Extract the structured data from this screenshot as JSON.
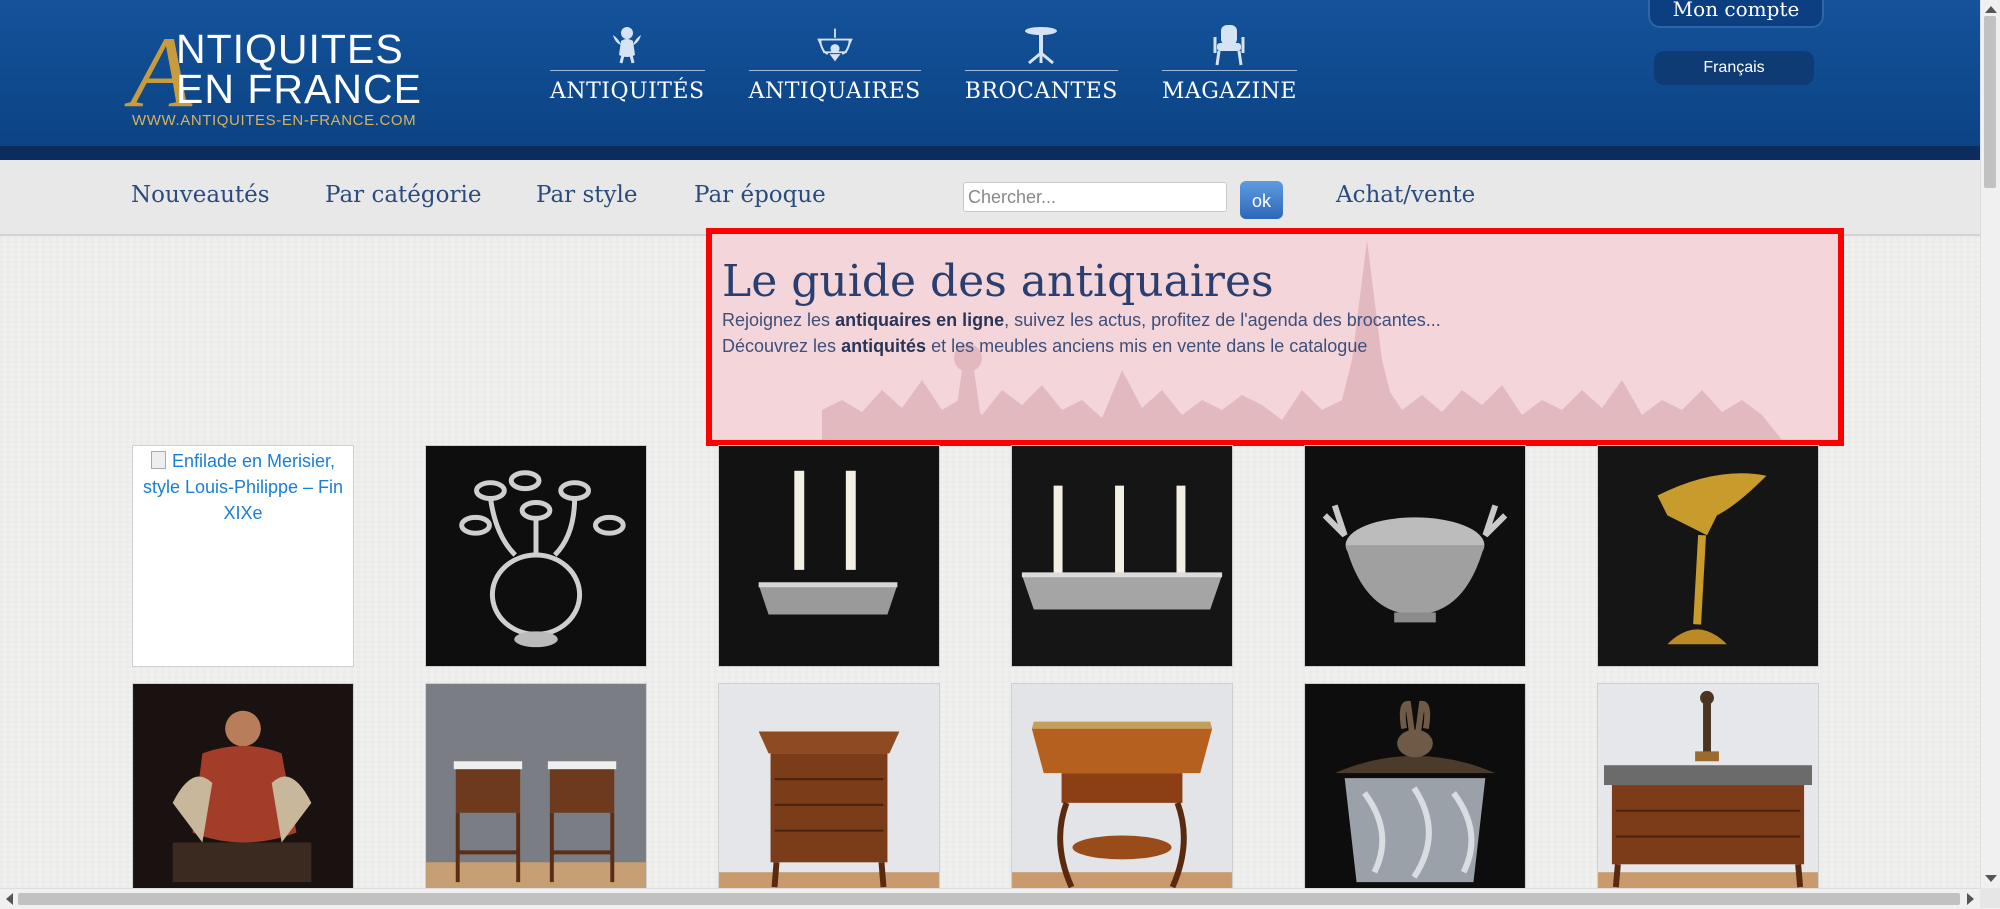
{
  "logo": {
    "line1": "NTIQUITES",
    "line2": "EN FRANCE",
    "big_letter": "A",
    "url": "WWW.ANTIQUITES-EN-FRANCE.COM"
  },
  "main_nav": [
    {
      "label": "ANTIQUITÉS",
      "icon": "cherub-icon"
    },
    {
      "label": "ANTIQUAIRES",
      "icon": "chandelier-icon"
    },
    {
      "label": "BROCANTES",
      "icon": "pedestal-table-icon"
    },
    {
      "label": "MAGAZINE",
      "icon": "armchair-icon"
    }
  ],
  "account": {
    "label": "Mon compte"
  },
  "language": {
    "label": "Français"
  },
  "sub_nav": {
    "items": [
      "Nouveautés",
      "Par catégorie",
      "Par style",
      "Par époque"
    ],
    "achat": "Achat/vente"
  },
  "search": {
    "placeholder": "Chercher...",
    "button": "ok"
  },
  "hero": {
    "title": "Le guide des antiquaires",
    "line1_pre": "Rejoignez les ",
    "line1_bold": "antiquaires en ligne",
    "line1_post": ", suivez les actus, profitez de l'agenda des brocantes...",
    "line2_pre": "Découvrez les ",
    "line2_bold": "antiquités",
    "line2_post": " et les meubles anciens mis en vente dans le catalogue"
  },
  "products": [
    {
      "alt": "Enfilade en Merisier, style Louis-Philippe – Fin XIXe",
      "broken": true
    },
    {
      "name": "crystal candelabra"
    },
    {
      "name": "silver two-candle holder"
    },
    {
      "name": "silver three-candle tray"
    },
    {
      "name": "silver bowl with stag heads"
    },
    {
      "name": "gilt eagle sculpture"
    },
    {
      "name": "carved angel sculpture"
    },
    {
      "name": "pair of bedside tables"
    },
    {
      "name": "small chest of drawers"
    },
    {
      "name": "marquetry side table"
    },
    {
      "name": "crystal jar with rabbit lid"
    },
    {
      "name": "marble-top commode with bronze figure"
    }
  ],
  "colors": {
    "header_blue": "#0f4a8e",
    "nav_link": "#2b4b7e",
    "gold": "#c89b3c",
    "highlight_border": "#ff0000"
  }
}
